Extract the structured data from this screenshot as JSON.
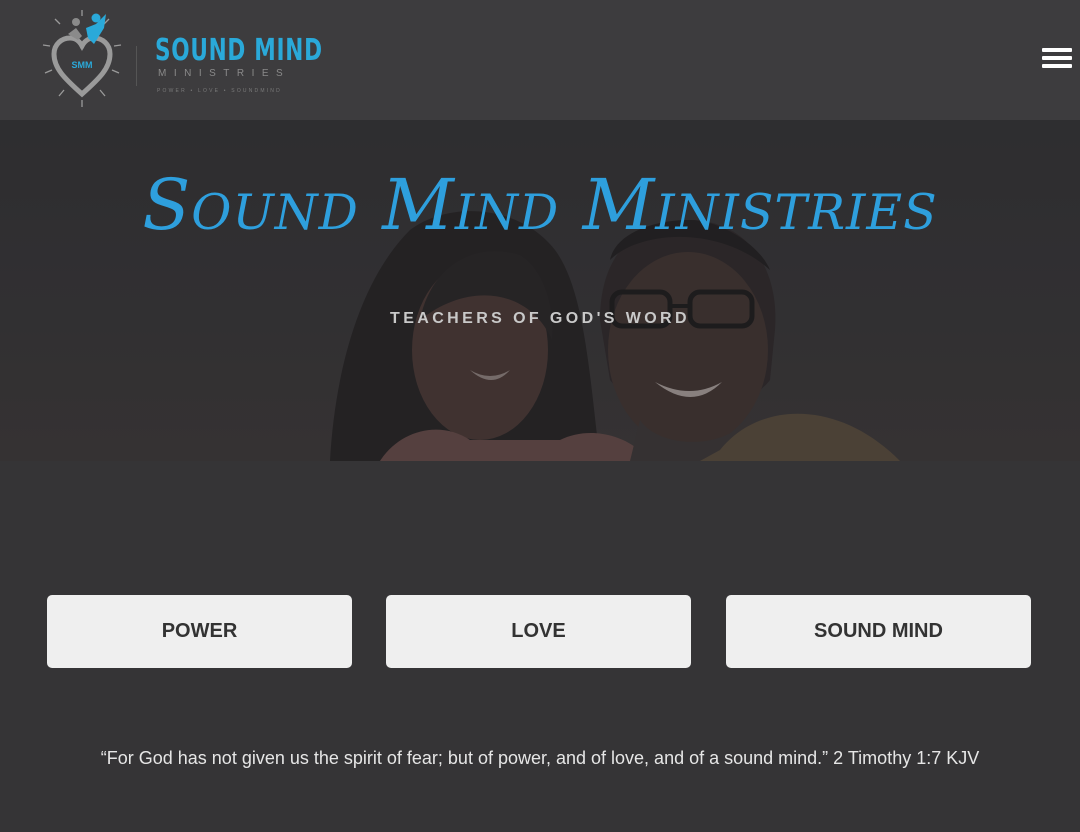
{
  "brand": {
    "logo_title": "SOUND MIND",
    "logo_subtitle": "MINISTRIES",
    "logo_tagline": "POWER • LOVE • SOUNDMIND",
    "logo_mark_text": "SMM",
    "accent_color": "#2aa9d9"
  },
  "header": {
    "menu_icon": "hamburger-icon"
  },
  "hero": {
    "title": "Sound Mind Ministries",
    "tagline": "TEACHERS OF GOD'S WORD"
  },
  "pillars": [
    {
      "label": "POWER"
    },
    {
      "label": "LOVE"
    },
    {
      "label": "SOUND MIND"
    }
  ],
  "quote": "“For God has not given us the spirit of fear; but of power, and of love, and of a sound mind.” 2 Timothy 1:7 KJV"
}
